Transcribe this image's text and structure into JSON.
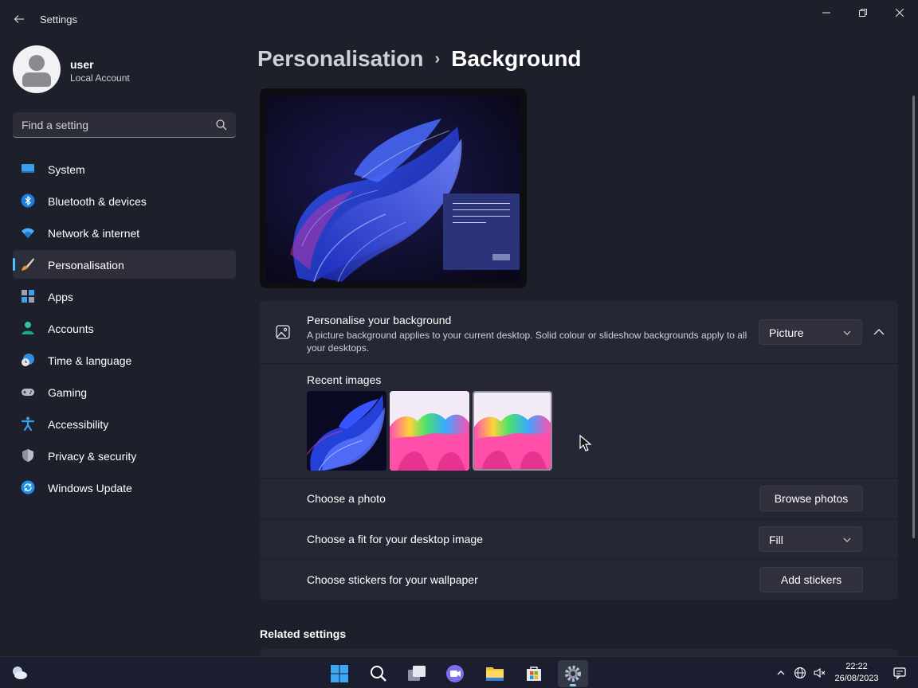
{
  "window": {
    "title": "Settings",
    "back_icon": "arrow-left-icon",
    "controls": [
      "minimize-icon",
      "restore-icon",
      "close-icon"
    ]
  },
  "profile": {
    "name": "user",
    "account_type": "Local Account"
  },
  "search": {
    "placeholder": "Find a setting",
    "icon": "search-icon"
  },
  "sidebar": {
    "items": [
      {
        "label": "System",
        "icon": "system-icon",
        "active": false
      },
      {
        "label": "Bluetooth & devices",
        "icon": "bluetooth-icon",
        "active": false
      },
      {
        "label": "Network & internet",
        "icon": "wifi-icon",
        "active": false
      },
      {
        "label": "Personalisation",
        "icon": "paintbrush-icon",
        "active": true
      },
      {
        "label": "Apps",
        "icon": "apps-icon",
        "active": false
      },
      {
        "label": "Accounts",
        "icon": "accounts-icon",
        "active": false
      },
      {
        "label": "Time & language",
        "icon": "clock-globe-icon",
        "active": false
      },
      {
        "label": "Gaming",
        "icon": "gamepad-icon",
        "active": false
      },
      {
        "label": "Accessibility",
        "icon": "accessibility-icon",
        "active": false
      },
      {
        "label": "Privacy & security",
        "icon": "shield-icon",
        "active": false
      },
      {
        "label": "Windows Update",
        "icon": "update-icon",
        "active": false
      }
    ]
  },
  "breadcrumb": {
    "parent": "Personalisation",
    "separator": "›",
    "current": "Background"
  },
  "background_card": {
    "title": "Personalise your background",
    "description": "A picture background applies to your current desktop. Solid colour or slideshow backgrounds apply to all your desktops.",
    "dropdown_value": "Picture",
    "recent_label": "Recent images",
    "recent_images": [
      "blue-bloom-wallpaper",
      "rainbow-wallpaper",
      "rainbow-wallpaper-selected"
    ]
  },
  "rows": {
    "choose_photo": {
      "label": "Choose a photo",
      "button": "Browse photos"
    },
    "choose_fit": {
      "label": "Choose a fit for your desktop image",
      "value": "Fill"
    },
    "stickers": {
      "label": "Choose stickers for your wallpaper",
      "button": "Add stickers"
    }
  },
  "related": {
    "heading": "Related settings"
  },
  "taskbar": {
    "apps": [
      "start-icon",
      "search-icon",
      "task-view-icon",
      "chat-icon",
      "file-explorer-icon",
      "store-icon",
      "settings-icon"
    ],
    "active_app": "settings-icon",
    "time": "22:22",
    "date": "26/08/2023"
  },
  "colors": {
    "accent": "#4cc2ff",
    "background": "#1d1f2a",
    "card": "#252734"
  }
}
